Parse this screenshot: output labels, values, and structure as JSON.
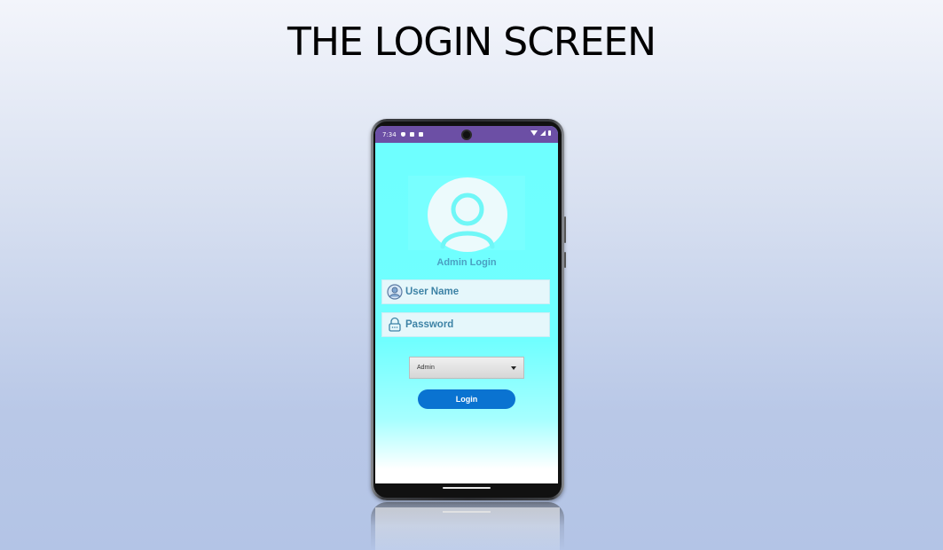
{
  "slide": {
    "title": "THE LOGIN SCREEN"
  },
  "status_bar": {
    "time": "7:34"
  },
  "app": {
    "heading": "Admin Login",
    "username": {
      "placeholder": "User Name"
    },
    "password": {
      "placeholder": "Password"
    },
    "role_select": {
      "selected": "Admin"
    },
    "login_button": {
      "label": "Login"
    }
  },
  "colors": {
    "status_bar": "#6c4fa5",
    "screen_bg": "#6effff",
    "field_text": "#3d83a6",
    "button": "#0a73d1"
  },
  "icons": [
    "user-avatar-icon",
    "user-icon",
    "lock-icon",
    "dropdown-caret-icon",
    "wifi-icon",
    "signal-icon",
    "battery-icon"
  ]
}
